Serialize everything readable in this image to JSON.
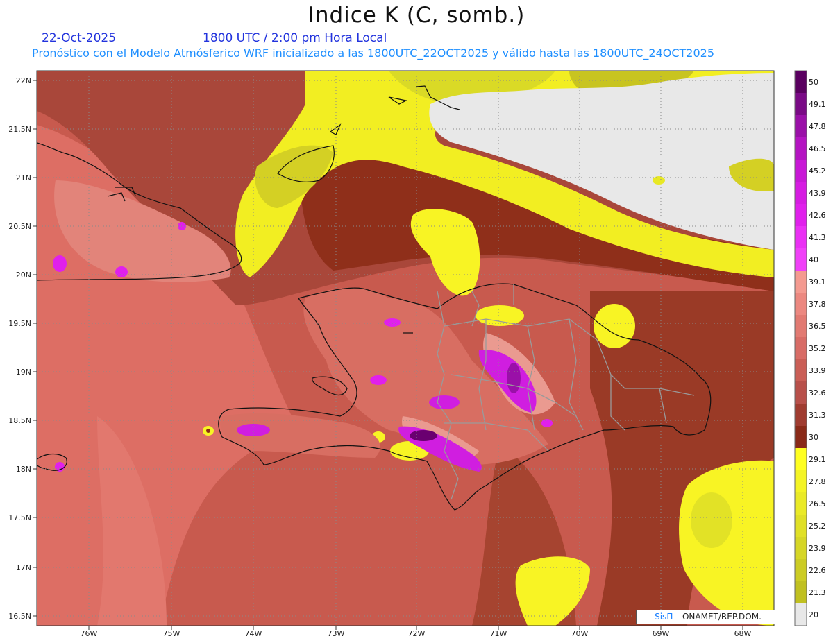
{
  "header": {
    "title": "Indice K (C, somb.)",
    "date": "22-Oct-2025",
    "time": "1800 UTC / 2:00 pm Hora Local",
    "subtitle": "Pronóstico con el Modelo Atmósferico WRF inicializado a las 1800UTC_22OCT2025 y válido hasta las  1800UTC_24OCT2025"
  },
  "axes": {
    "lat_labels": [
      "22N",
      "21.5N",
      "21N",
      "20.5N",
      "20N",
      "19.5N",
      "19N",
      "18.5N",
      "18N",
      "17.5N",
      "17N",
      "16.5N"
    ],
    "lon_labels": [
      "76W",
      "75W",
      "74W",
      "73W",
      "72W",
      "71W",
      "70W",
      "69W",
      "68W"
    ]
  },
  "colorbar": {
    "levels": [
      "50",
      "49.1",
      "47.8",
      "46.5",
      "45.2",
      "43.9",
      "42.6",
      "41.3",
      "40",
      "39.1",
      "37.8",
      "36.5",
      "35.2",
      "33.9",
      "32.6",
      "31.3",
      "30",
      "29.1",
      "27.8",
      "26.5",
      "25.2",
      "23.9",
      "22.6",
      "21.3",
      "20"
    ],
    "colors": [
      "#5a0060",
      "#7a0a86",
      "#9a10a8",
      "#b414c2",
      "#c818d6",
      "#d61ce2",
      "#e020ec",
      "#ea30f4",
      "#f040f8",
      "#f49a90",
      "#ec8880",
      "#e27a72",
      "#d86c66",
      "#ca5e56",
      "#b8504a",
      "#a03c30",
      "#8a2a18",
      "#ffff20",
      "#f4f424",
      "#eaea26",
      "#e0e026",
      "#d6d626",
      "#cccc24",
      "#c0c020",
      "#e8e8e8"
    ]
  },
  "credit": {
    "brand": "SisΠ",
    "text": "– ONAMET/REP.DOM."
  }
}
